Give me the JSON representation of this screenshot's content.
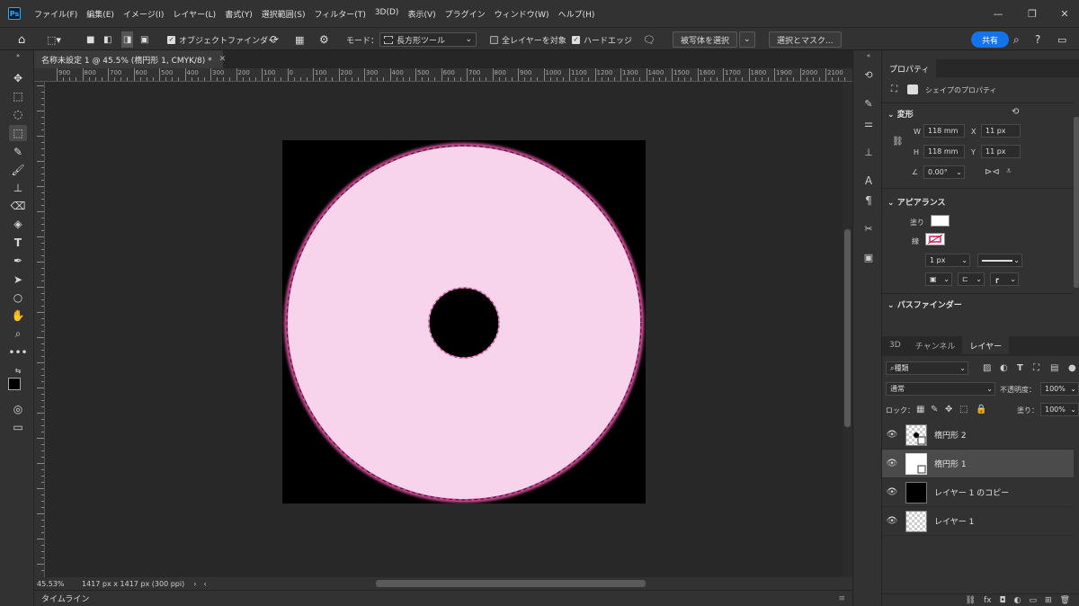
{
  "app": {
    "logo": "Ps"
  },
  "menu": [
    "ファイル(F)",
    "編集(E)",
    "イメージ(I)",
    "レイヤー(L)",
    "書式(Y)",
    "選択範囲(S)",
    "フィルター(T)",
    "3D(D)",
    "表示(V)",
    "プラグイン",
    "ウィンドウ(W)",
    "ヘルプ(H)"
  ],
  "options": {
    "object_finder": "オブジェクトファインダー",
    "mode_label": "モード：",
    "mode_value": "長方形ツール",
    "all_layers": "全レイヤーを対象",
    "hard_edge": "ハードエッジ",
    "select_subject": "被写体を選択",
    "select_mask": "選択とマスク...",
    "share": "共有"
  },
  "document": {
    "tab_title": "名称未設定 1 @ 45.5% (楕円形 1, CMYK/8) *",
    "zoom": "45.53%",
    "size_info": "1417 px x 1417 px (300 ppi)"
  },
  "ruler": [
    "900",
    "800",
    "700",
    "600",
    "500",
    "400",
    "300",
    "200",
    "100",
    "0",
    "100",
    "200",
    "300",
    "400",
    "500",
    "600",
    "700",
    "800",
    "900",
    "1000",
    "1100",
    "1200",
    "1300",
    "1400",
    "1500",
    "1600",
    "1700",
    "1800",
    "1900",
    "2000",
    "2100"
  ],
  "timeline_label": "タイムライン",
  "properties": {
    "tab": "プロパティ",
    "shape_props": "シェイプのプロパティ",
    "transform": "変形",
    "w_label": "W",
    "w_value": "118 mm",
    "h_label": "H",
    "h_value": "118 mm",
    "x_label": "X",
    "x_value": "11 px",
    "y_label": "Y",
    "y_value": "11 px",
    "angle": "0.00°",
    "appearance": "アピアランス",
    "fill_label": "塗り",
    "stroke_label": "線",
    "stroke_width": "1 px",
    "pathfinder": "パスファインダー"
  },
  "layers_panel": {
    "tabs": [
      "3D",
      "チャンネル",
      "レイヤー"
    ],
    "filter": "種類",
    "blend": "通常",
    "opacity_label": "不透明度：",
    "opacity": "100%",
    "lock_label": "ロック：",
    "fill_label": "塗り：",
    "fill": "100%",
    "layers": [
      {
        "name": "楕円形 2",
        "selected": false
      },
      {
        "name": "楕円形 1",
        "selected": true
      },
      {
        "name": "レイヤー 1 のコピー",
        "selected": false
      },
      {
        "name": "レイヤー 1",
        "selected": false
      }
    ]
  },
  "colors": {
    "shape_fill": "#f8d3ec",
    "shape_stroke": "#d9539c",
    "artboard": "#000000",
    "accent": "#1473e6"
  }
}
